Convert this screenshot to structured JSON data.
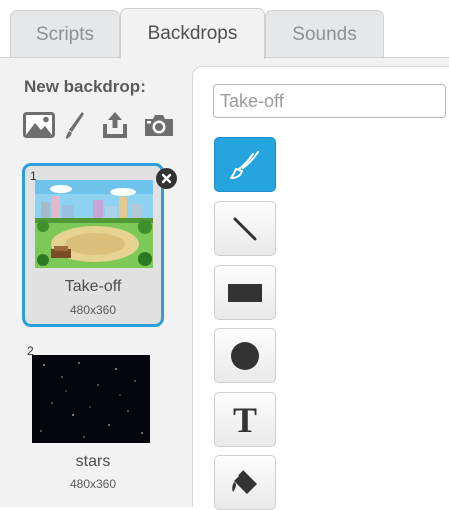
{
  "tabs": [
    {
      "label": "Scripts"
    },
    {
      "label": "Backdrops"
    },
    {
      "label": "Sounds"
    }
  ],
  "sidebar": {
    "new_backdrop_label": "New backdrop:",
    "tools": [
      "paint-new-icon",
      "paint-brush-icon",
      "upload-icon",
      "camera-icon"
    ],
    "backdrops": [
      {
        "number": "1",
        "name": "Take-off",
        "size": "480x360",
        "selected": true
      },
      {
        "number": "2",
        "name": "stars",
        "size": "480x360",
        "selected": false
      }
    ]
  },
  "editor": {
    "costume_name": "Take-off",
    "tools": [
      "brush-tool-icon",
      "line-tool-icon",
      "rectangle-tool-icon",
      "ellipse-tool-icon",
      "text-tool-icon",
      "fill-tool-icon"
    ],
    "text_tool_glyph": "T"
  },
  "colors": {
    "accent": "#25a4e0",
    "selection_border": "#2b9fd9",
    "panel_bg": "#f2f2f2"
  }
}
